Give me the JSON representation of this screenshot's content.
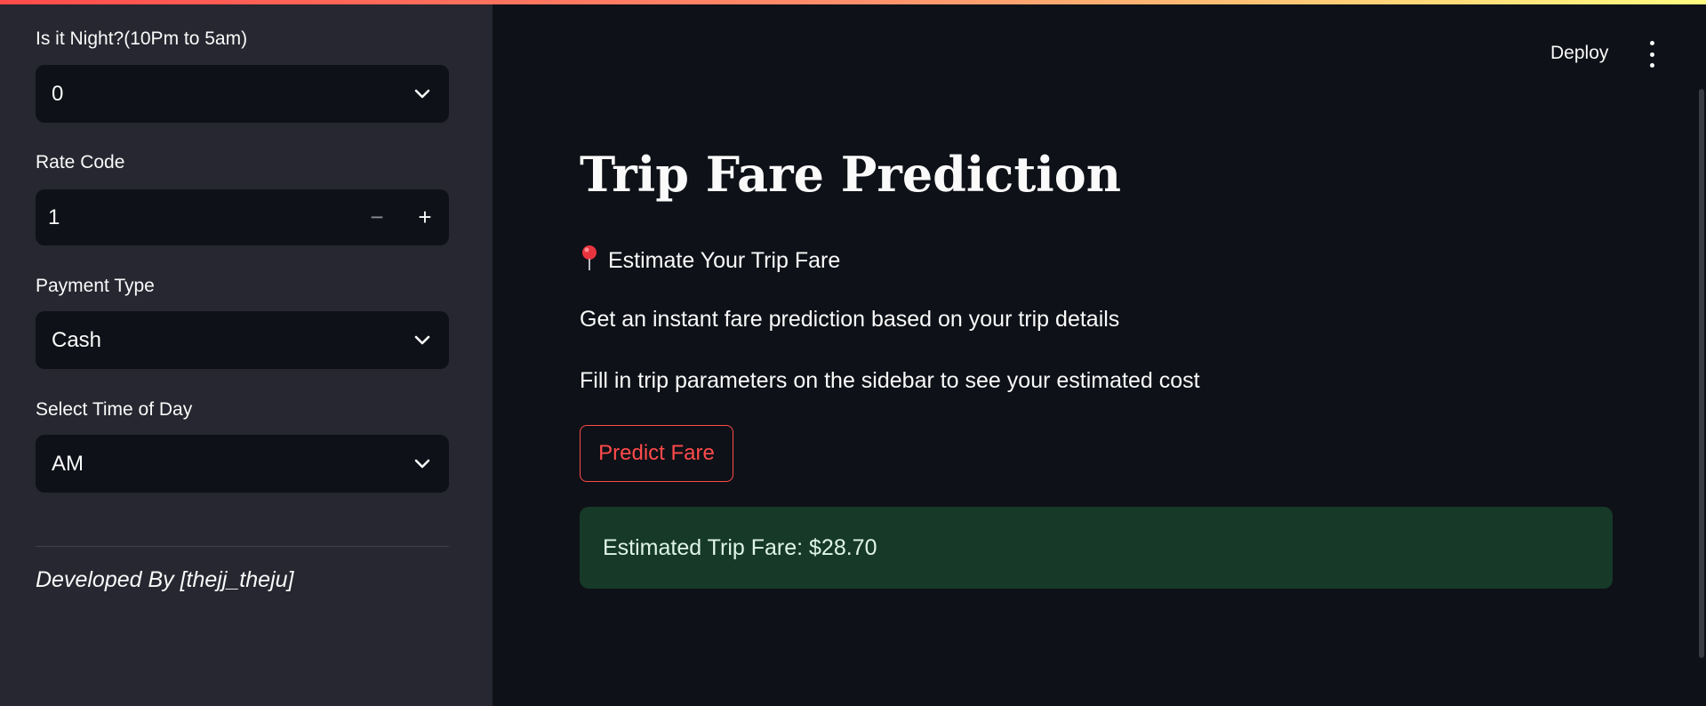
{
  "sidebar": {
    "night": {
      "label": "Is it Night?(10Pm to 5am)",
      "value": "0"
    },
    "rate_code": {
      "label": "Rate Code",
      "value": "1",
      "minus": "−",
      "plus": "+"
    },
    "payment_type": {
      "label": "Payment Type",
      "value": "Cash"
    },
    "time_of_day": {
      "label": "Select Time of Day",
      "value": "AM"
    },
    "credit": "Developed By [thejj_theju]"
  },
  "header": {
    "deploy_label": "Deploy",
    "menu_icon": "kebab-menu-icon"
  },
  "main": {
    "title": "Trip Fare Prediction",
    "subheading_icon": "pushpin-icon",
    "subheading": "Estimate Your Trip Fare",
    "description": "Get an instant fare prediction based on your trip details",
    "instruction": "Fill in trip parameters on the sidebar to see your estimated cost",
    "predict_button": "Predict Fare",
    "result": "Estimated Trip Fare: $28.70"
  },
  "colors": {
    "accent": "#ff4b4b",
    "sidebar_bg": "#262730",
    "main_bg": "#0e1117",
    "success_bg": "#173928"
  }
}
